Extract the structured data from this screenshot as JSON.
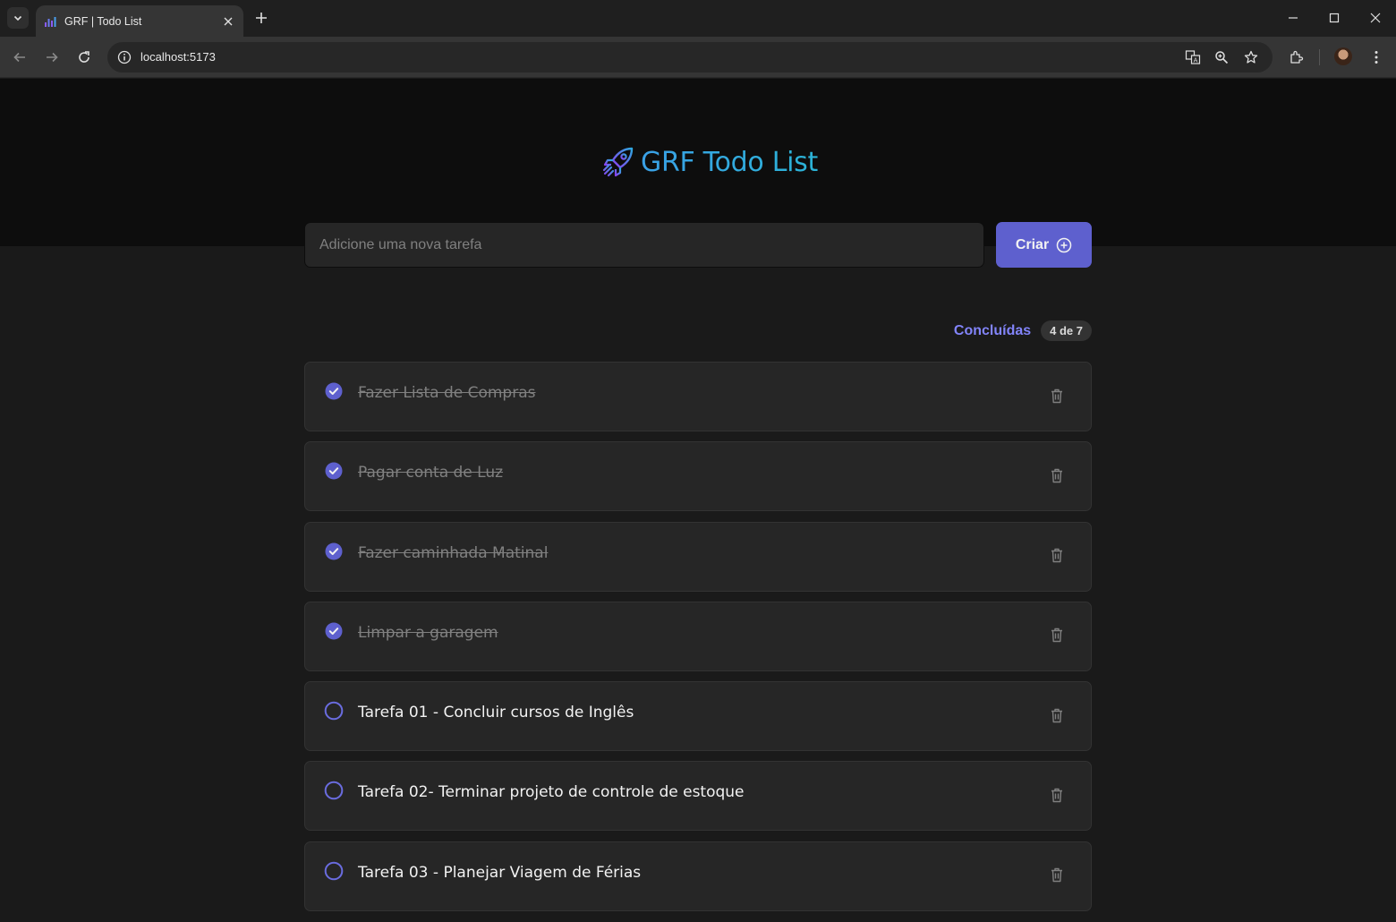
{
  "browser": {
    "tab_title": "GRF | Todo List",
    "url": "localhost:5173"
  },
  "app": {
    "brand": "GRF Todo List",
    "input_placeholder": "Adicione uma nova tarefa",
    "create_label": "Criar",
    "accent_color": "#5e60ce",
    "done_label_color": "#8284fa"
  },
  "counter": {
    "label": "Concluídas",
    "value": "4 de 7"
  },
  "tasks": [
    {
      "text": "Fazer Lista de Compras",
      "done": true
    },
    {
      "text": "Pagar conta de Luz",
      "done": true
    },
    {
      "text": "Fazer caminhada Matinal",
      "done": true
    },
    {
      "text": "Limpar a garagem",
      "done": true
    },
    {
      "text": "Tarefa 01 - Concluir cursos de Inglês",
      "done": false
    },
    {
      "text": "Tarefa 02- Terminar projeto de controle de estoque",
      "done": false
    },
    {
      "text": "Tarefa 03 - Planejar Viagem de Férias",
      "done": false
    }
  ]
}
